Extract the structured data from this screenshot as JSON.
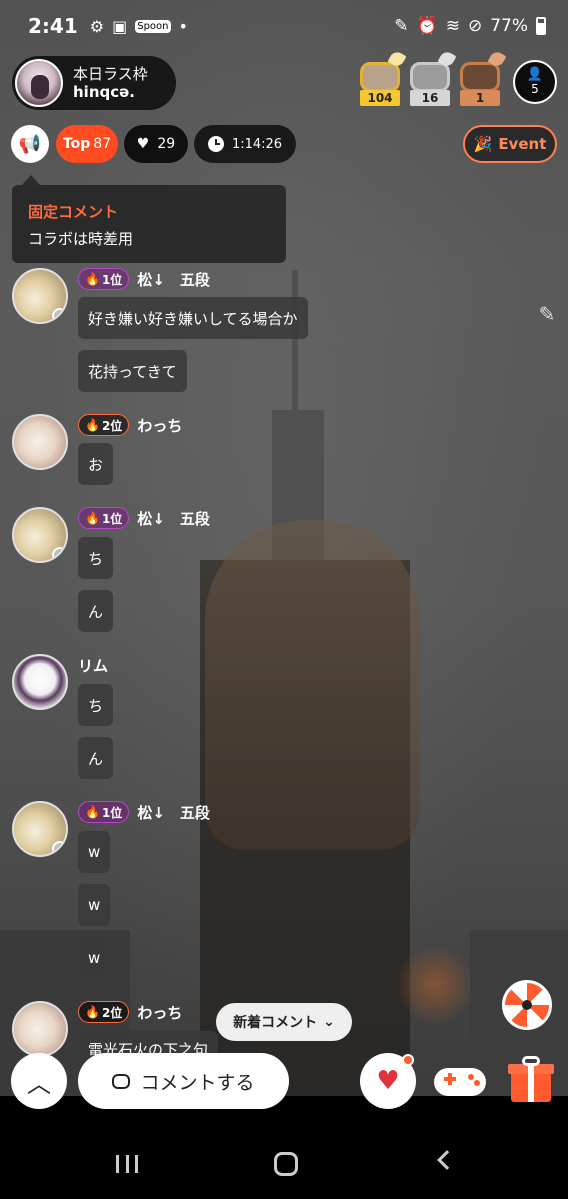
{
  "status_bar": {
    "time": "2:41",
    "battery": "77%",
    "left_icons": [
      "gear-icon",
      "image-icon",
      "spoon-app-icon",
      "dot-icon"
    ],
    "right_icons": [
      "pen-icon",
      "alarm-icon",
      "wifi-icon",
      "dnd-icon",
      "battery-icon"
    ]
  },
  "header": {
    "stream_title": "本日ラス枠",
    "host_name": "hinqcә.",
    "top_fans": [
      {
        "count": "104",
        "tier": "gold"
      },
      {
        "count": "16",
        "tier": "silver"
      },
      {
        "count": "1",
        "tier": "bronze"
      }
    ],
    "listener_count": "5"
  },
  "toolbar": {
    "top_label": "Top",
    "top_value": "87",
    "likes": "29",
    "elapsed": "1:14:26",
    "event_label": "Event"
  },
  "pinned": {
    "title": "固定コメント",
    "body": "コラボは時差用"
  },
  "comments": [
    {
      "rank": "1位",
      "user": "松↓　五段",
      "messages": [
        "好き嫌い好き嫌いしてる場合か",
        "花持ってきて"
      ]
    },
    {
      "rank": "2位",
      "user": "わっち",
      "messages": [
        "お"
      ]
    },
    {
      "rank": "1位",
      "user": "松↓　五段",
      "messages": [
        "ち",
        "ん"
      ]
    },
    {
      "rank": "",
      "user": "リム",
      "messages": [
        "ち",
        "ん"
      ]
    },
    {
      "rank": "1位",
      "user": "松↓　五段",
      "messages": [
        "w",
        "w",
        "w"
      ]
    },
    {
      "rank": "2位",
      "user": "わっち",
      "messages": [
        "電光石火の下之句"
      ]
    }
  ],
  "new_comment_label": "新着コメント",
  "bottom": {
    "comment_placeholder": "コメントする"
  },
  "colors": {
    "accent": "#ff4b1f",
    "event_border": "#ff7f50",
    "pinned_title": "#ff6a3d",
    "rank1_badge": "#b847c8",
    "rank2_badge": "#ff6b3c"
  }
}
